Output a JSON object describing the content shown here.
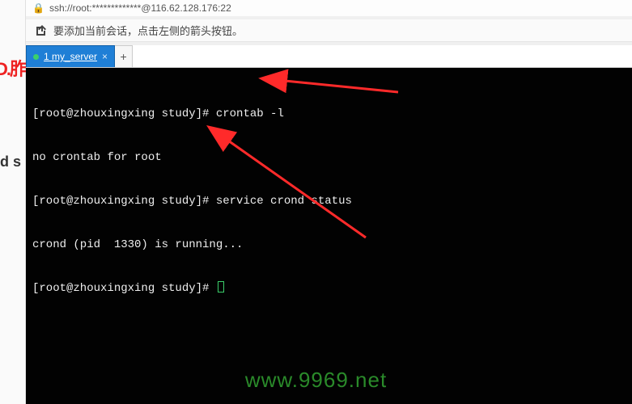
{
  "addr": {
    "text": "ssh://root:*************@116.62.128.176:22"
  },
  "tip": {
    "text": "要添加当前会话，点击左侧的箭头按钮。"
  },
  "tabs": {
    "items": [
      {
        "label": "1 my_server"
      }
    ],
    "add_label": "+"
  },
  "terminal": {
    "lines": [
      {
        "prompt": "[root@zhouxingxing study]# ",
        "cmd": "crontab -l",
        "cursor": false
      },
      {
        "prompt": "",
        "cmd": "no crontab for root",
        "cursor": false
      },
      {
        "prompt": "[root@zhouxingxing study]# ",
        "cmd": "service crond status",
        "cursor": false
      },
      {
        "prompt": "",
        "cmd": "crond (pid  1330) is running...",
        "cursor": false
      },
      {
        "prompt": "[root@zhouxingxing study]# ",
        "cmd": "",
        "cursor": true
      }
    ]
  },
  "left_fragments": {
    "f1": "D.胙",
    "f2": "d s"
  },
  "watermark": "www.9969.net"
}
